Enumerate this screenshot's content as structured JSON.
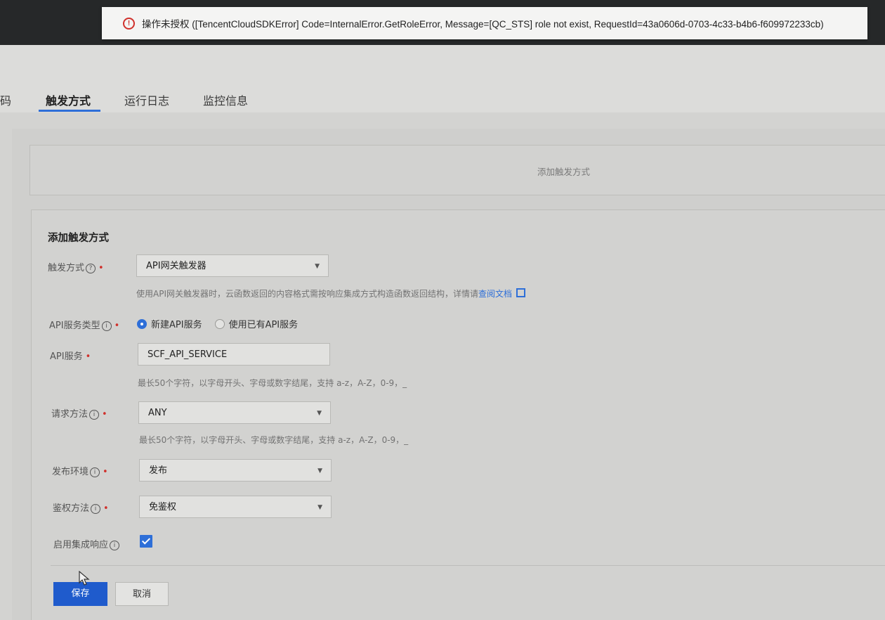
{
  "error_toast": {
    "message": "操作未授权 ([TencentCloudSDKError] Code=InternalError.GetRoleError, Message=[QC_STS] role not exist, RequestId=43a0606d-0703-4c33-b4b6-f609972233cb)"
  },
  "tabs": [
    {
      "label": "码"
    },
    {
      "label": "触发方式"
    },
    {
      "label": "运行日志"
    },
    {
      "label": "监控信息"
    }
  ],
  "add_trigger_box": {
    "label": "添加触发方式"
  },
  "form": {
    "title": "添加触发方式",
    "trigger_type": {
      "label": "触发方式",
      "value": "API网关触发器",
      "hint": "使用API网关触发器时，云函数返回的内容格式需按响应集成方式构造函数返回结构，详情请",
      "hint_link": "查阅文档"
    },
    "api_service_type": {
      "label": "API服务类型",
      "options": [
        "新建API服务",
        "使用已有API服务"
      ],
      "selected": "新建API服务"
    },
    "api_service": {
      "label": "API服务",
      "value": "SCF_API_SERVICE",
      "hint": "最长50个字符，以字母开头、字母或数字结尾，支持 a-z，A-Z，0-9，_"
    },
    "request_method": {
      "label": "请求方法",
      "value": "ANY",
      "hint": "最长50个字符，以字母开头、字母或数字结尾，支持 a-z，A-Z，0-9，_"
    },
    "publish_env": {
      "label": "发布环境",
      "value": "发布"
    },
    "auth_method": {
      "label": "鉴权方法",
      "value": "免鉴权"
    },
    "integration_response": {
      "label": "启用集成响应",
      "checked": true
    }
  },
  "buttons": {
    "save": "保存",
    "cancel": "取消"
  },
  "colors": {
    "accent": "#2e6fd8",
    "error": "#d0312c",
    "primary_button": "#1f5bcc"
  }
}
